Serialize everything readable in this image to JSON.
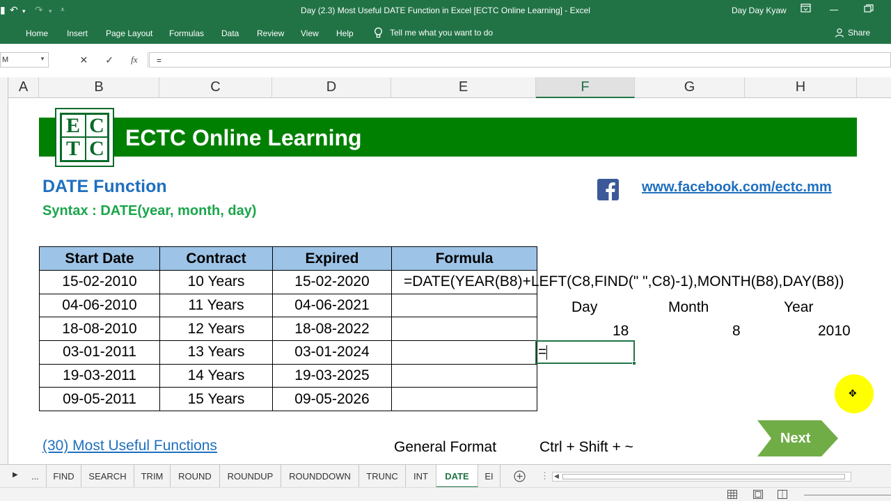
{
  "window": {
    "title": "Day (2.3) Most Useful DATE Function in Excel [ECTC Online Learning]  -  Excel",
    "user": "Day Day Kyaw"
  },
  "ribbon": {
    "tabs": [
      "Home",
      "Insert",
      "Page Layout",
      "Formulas",
      "Data",
      "Review",
      "View",
      "Help"
    ],
    "tell_me": "Tell me what you want to do",
    "share": "Share"
  },
  "formula_bar": {
    "name_box": "M",
    "content": "="
  },
  "columns": [
    "A",
    "B",
    "C",
    "D",
    "E",
    "F",
    "G",
    "H"
  ],
  "banner": {
    "title": "ECTC Online Learning",
    "logo_letters": [
      "E",
      "C",
      "T",
      "C"
    ]
  },
  "heading": {
    "title": "DATE Function",
    "syntax": "Syntax : DATE(year, month, day)",
    "facebook_url": "www.facebook.com/ectc.mm"
  },
  "table": {
    "headers": [
      "Start Date",
      "Contract",
      "Expired",
      "Formula"
    ],
    "rows": [
      [
        "15-02-2010",
        "10 Years",
        "15-02-2020",
        ""
      ],
      [
        "04-06-2010",
        "11 Years",
        "04-06-2021",
        ""
      ],
      [
        "18-08-2010",
        "12 Years",
        "18-08-2022",
        ""
      ],
      [
        "03-01-2011",
        "13 Years",
        "03-01-2024",
        ""
      ],
      [
        "19-03-2011",
        "14 Years",
        "19-03-2025",
        ""
      ],
      [
        "09-05-2011",
        "15 Years",
        "09-05-2026",
        ""
      ]
    ],
    "formula_text": "=DATE(YEAR(B8)+LEFT(C8,FIND(\" \",C8)-1),MONTH(B8),DAY(B8))"
  },
  "parts": {
    "labels": [
      "Day",
      "Month",
      "Year"
    ],
    "values": [
      "18",
      "8",
      "2010"
    ]
  },
  "active_cell": {
    "content": "="
  },
  "footer": {
    "link": "(30) Most Useful Functions",
    "general_format": "General Format",
    "shortcut": "Ctrl + Shift + ~",
    "next": "Next"
  },
  "sheet_tabs": {
    "items": [
      "...",
      "FIND",
      "SEARCH",
      "TRIM",
      "ROUND",
      "ROUNDUP",
      "ROUNDDOWN",
      "TRUNC",
      "INT",
      "DATE",
      "EI"
    ],
    "active": "DATE"
  },
  "colors": {
    "excel_green": "#217346",
    "banner_green": "#008000",
    "header_blue": "#9dc3e6",
    "title_blue": "#1f6fbf",
    "syntax_green": "#1aa54b",
    "next_green": "#70ad47"
  }
}
